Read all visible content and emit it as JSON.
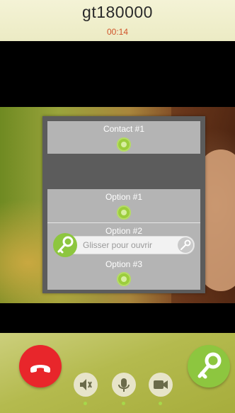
{
  "call": {
    "name": "gt180000",
    "timer": "00:14"
  },
  "menu": {
    "contact_label": "Contact #1",
    "options": [
      "Option #1",
      "Option #2",
      "Option #3"
    ]
  },
  "slider": {
    "label": "Glisser pour ouvrir"
  },
  "controls": {
    "hangup": "hangup-icon",
    "open_door": "key-icon",
    "speaker": "speaker-icon",
    "mic": "microphone-icon",
    "video": "camera-icon"
  },
  "colors": {
    "accent_green": "#8dc63f",
    "hangup_red": "#e8262b",
    "timer_orange": "#d0542a"
  }
}
